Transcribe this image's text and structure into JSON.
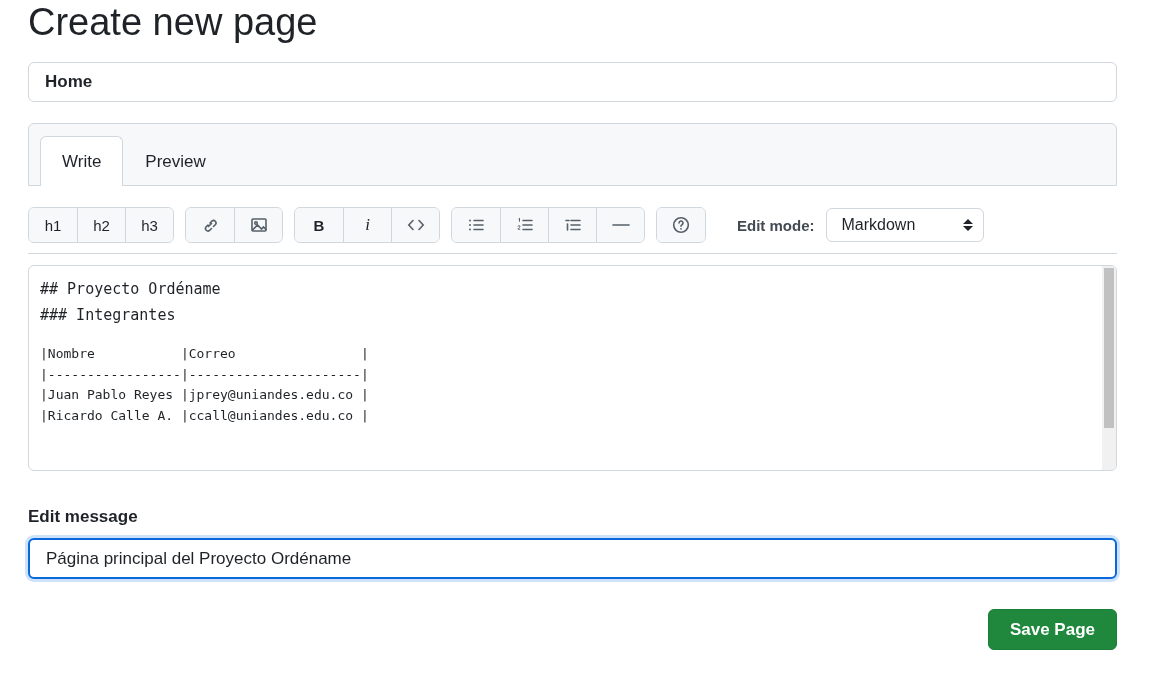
{
  "title": "Create new page",
  "page_name": {
    "value": "Home"
  },
  "tabs": [
    {
      "label": "Write",
      "selected": true
    },
    {
      "label": "Preview",
      "selected": false
    }
  ],
  "toolbar": {
    "groups": [
      {
        "items": [
          {
            "kind": "text",
            "label": "h1"
          },
          {
            "kind": "text",
            "label": "h2"
          },
          {
            "kind": "text",
            "label": "h3"
          }
        ]
      },
      {
        "items": [
          {
            "kind": "link"
          },
          {
            "kind": "image"
          }
        ]
      },
      {
        "items": [
          {
            "kind": "bold",
            "label": "B"
          },
          {
            "kind": "italic",
            "label": "i"
          },
          {
            "kind": "code"
          }
        ]
      },
      {
        "items": [
          {
            "kind": "bullets"
          },
          {
            "kind": "numbers"
          },
          {
            "kind": "tasks"
          },
          {
            "kind": "rule"
          }
        ]
      },
      {
        "items": [
          {
            "kind": "help"
          }
        ]
      }
    ],
    "edit_mode_label": "Edit mode:",
    "edit_mode": "Markdown"
  },
  "editor": {
    "lines": [
      {
        "kind": "heading",
        "text": "## Proyecto Ordéname"
      },
      {
        "kind": "heading",
        "text": "### Integrantes"
      },
      {
        "kind": "plain",
        "text": "|Nombre           |Correo                |"
      },
      {
        "kind": "plain",
        "text": "|-----------------|----------------------|"
      },
      {
        "kind": "plain",
        "text": "|Juan Pablo Reyes |jprey@uniandes.edu.co |"
      },
      {
        "kind": "plain",
        "text": "|Ricardo Calle A. |ccall@uniandes.edu.co |"
      }
    ]
  },
  "edit_message": {
    "label": "Edit message",
    "value": "Página principal del Proyecto Ordéname",
    "focused": true
  },
  "save_button": "Save Page"
}
